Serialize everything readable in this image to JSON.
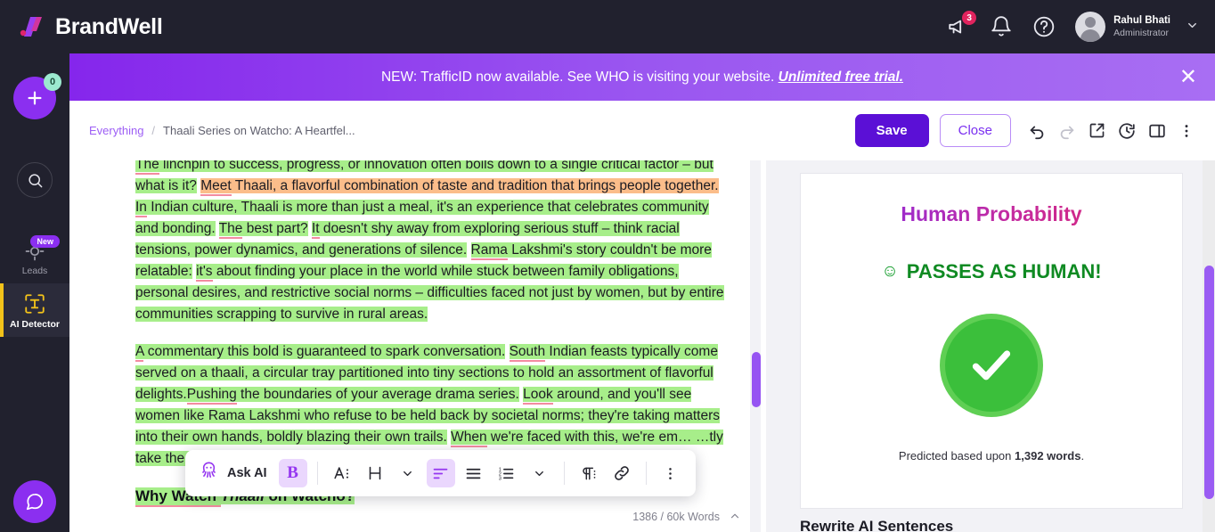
{
  "topbar": {
    "brand_name": "BrandWell",
    "logo_icon": "brandwell-logo-icon",
    "announce_icon": "megaphone-icon",
    "announce_count": "3",
    "bell_icon": "bell-icon",
    "help_icon": "question-circle-icon",
    "avatar_icon": "user-avatar",
    "user_name": "Rahul Bhati",
    "user_role": "Administrator",
    "caret_icon": "chevron-down-icon"
  },
  "rail": {
    "create_icon": "plus-icon",
    "create_count": "0",
    "search_icon": "search-icon",
    "items": [
      {
        "label": "Leads",
        "icon": "target-crosshair-icon",
        "badge": "New",
        "active": false
      },
      {
        "label": "AI Detector",
        "icon": "scan-text-icon",
        "badge": "",
        "active": true
      }
    ],
    "chat_icon": "chat-bubble-icon"
  },
  "banner": {
    "text": "NEW: TrafficID now available. See WHO is visiting your website.",
    "link": "Unlimited free trial.",
    "close_icon": "close-icon"
  },
  "subheader": {
    "breadcrumb_root": "Everything",
    "breadcrumb_sep": "/",
    "breadcrumb_current": "Thaali Series on Watcho: A Heartfel...",
    "save_label": "Save",
    "close_label": "Close",
    "icons": [
      "undo-icon",
      "redo-icon",
      "share-external-icon",
      "history-clock-icon",
      "toggle-panel-icon",
      "more-vertical-icon"
    ]
  },
  "editor": {
    "paragraphs": [
      {
        "runs": [
          {
            "t": "The linchpin to success, progress, or innovation often boils down to a single critical factor – but what is it?",
            "hl": "green",
            "uw": true
          },
          {
            "t": " ",
            "hl": "none",
            "uw": false
          },
          {
            "t": "Meet Thaali, a flavorful combination of taste and tradition that brings people together.",
            "hl": "orange",
            "uw": true
          },
          {
            "t": " ",
            "hl": "none",
            "uw": false
          },
          {
            "t": "In Indian culture, Thaali is more than just a meal, it's an experience that celebrates community and bonding.",
            "hl": "green",
            "uw": true
          },
          {
            "t": " ",
            "hl": "none",
            "uw": false
          },
          {
            "t": "The best part?",
            "hl": "green",
            "uw": true
          },
          {
            "t": " ",
            "hl": "none",
            "uw": false
          },
          {
            "t": "It doesn't shy away from exploring serious stuff – think racial tensions, power dynamics, and generations of silence.",
            "hl": "green",
            "uw": true
          },
          {
            "t": " ",
            "hl": "none",
            "uw": false
          },
          {
            "t": "Rama Lakshmi's story couldn't be more relatable:",
            "hl": "green",
            "uw": true
          },
          {
            "t": " ",
            "hl": "none",
            "uw": false
          },
          {
            "t": "it's about finding your place in the world while stuck between family obligations, personal desires, and restrictive social norms – difficulties faced not just by women, but by entire communities scrapping to survive in rural areas.",
            "hl": "green",
            "uw": true
          }
        ]
      },
      {
        "runs": [
          {
            "t": "A commentary this bold is guaranteed to spark conversation.",
            "hl": "green",
            "uw": true
          },
          {
            "t": " ",
            "hl": "none",
            "uw": false
          },
          {
            "t": "South Indian feasts typically come served on a thaali, a circular tray partitioned into tiny sections to hold an assortment of flavorful delights.",
            "hl": "green",
            "uw": true
          },
          {
            "t": "Pushing the boundaries of your average drama series.",
            "hl": "green",
            "uw": true
          },
          {
            "t": " ",
            "hl": "none",
            "uw": false
          },
          {
            "t": "Look around, and you'll see women like Rama Lakshmi who refuse to be held back by societal norms; they're taking matters into their own hands, boldly blazing their own trails.",
            "hl": "green",
            "uw": true
          },
          {
            "t": " ",
            "hl": "none",
            "uw": false
          },
          {
            "t": "When we're faced with this, we're em… …tly take the first s…",
            "hl": "green",
            "uw": true
          }
        ]
      }
    ],
    "heading": {
      "pre": "Why Watch ",
      "em": "Thaali",
      "post": " on Watcho?"
    },
    "word_count": "1386 / 60k Words",
    "collapse_icon": "chevron-up-icon"
  },
  "format_toolbar": {
    "ask_ai_icon": "octopus-ai-icon",
    "ask_ai_label": "Ask AI",
    "bold_label": "B",
    "font_icon": "font-size-icon",
    "heading_icon": "heading-icon",
    "heading_caret_icon": "chevron-down-icon",
    "align_icon": "align-left-icon",
    "list_icon": "bullet-list-icon",
    "numlist_icon": "numbered-list-icon",
    "list_caret_icon": "chevron-down-icon",
    "paragraph_icon": "paragraph-style-icon",
    "link_icon": "link-icon",
    "more_icon": "more-vertical-icon"
  },
  "right_panel": {
    "card_title": "Human Probability",
    "verdict_emoji": "☺",
    "verdict_text": "PASSES AS HUMAN!",
    "check_icon": "green-check-circle-icon",
    "predicted_prefix": "Predicted based upon ",
    "predicted_words": "1,392 words",
    "predicted_suffix": ".",
    "rewrite_title": "Rewrite AI Sentences"
  },
  "colors": {
    "brand_purple": "#8b2ff0",
    "save_purple": "#5b10d6",
    "accent_yellow": "#f2c21a",
    "highlight_green": "#a7ee8a",
    "highlight_orange": "#fbbd8a",
    "underline_pink": "#f38ba0",
    "success_green": "#3bbf3b"
  }
}
